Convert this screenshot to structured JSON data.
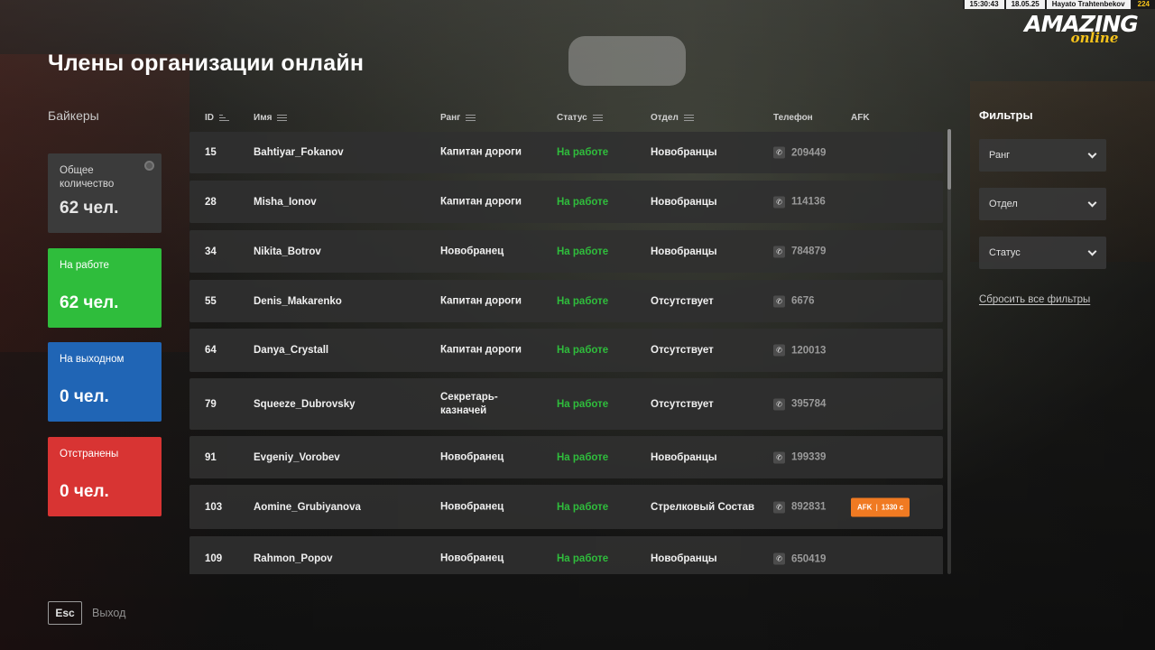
{
  "hud": {
    "time": "15:30:43",
    "date": "18.05.25",
    "player": "Hayato Trahtenbekov",
    "player_id": "224"
  },
  "logo": {
    "line1": "AMAZING",
    "line2": "online"
  },
  "page_title": "Члены организации онлайн",
  "org_name": "Байкеры",
  "stats": {
    "total": {
      "label": "Общее количество",
      "value": "62 чел."
    },
    "working": {
      "label": "На работе",
      "value": "62 чел."
    },
    "day_off": {
      "label": "На выходном",
      "value": "0 чел."
    },
    "suspended": {
      "label": "Отстранены",
      "value": "0 чел."
    }
  },
  "columns": {
    "id": "ID",
    "name": "Имя",
    "rank": "Ранг",
    "status": "Статус",
    "dept": "Отдел",
    "phone": "Телефон",
    "afk": "AFK"
  },
  "members": [
    {
      "id": "15",
      "name": "Bahtiyar_Fokanov",
      "rank": "Капитан дороги",
      "status": "На работе",
      "dept": "Новобранцы",
      "phone": "209449",
      "afk": ""
    },
    {
      "id": "28",
      "name": "Misha_Ionov",
      "rank": "Капитан дороги",
      "status": "На работе",
      "dept": "Новобранцы",
      "phone": "114136",
      "afk": ""
    },
    {
      "id": "34",
      "name": "Nikita_Botrov",
      "rank": "Новобранец",
      "status": "На работе",
      "dept": "Новобранцы",
      "phone": "784879",
      "afk": ""
    },
    {
      "id": "55",
      "name": "Denis_Makarenko",
      "rank": "Капитан дороги",
      "status": "На работе",
      "dept": "Отсутствует",
      "phone": "6676",
      "afk": ""
    },
    {
      "id": "64",
      "name": "Danya_Crystall",
      "rank": "Капитан дороги",
      "status": "На работе",
      "dept": "Отсутствует",
      "phone": "120013",
      "afk": ""
    },
    {
      "id": "79",
      "name": "Squeeze_Dubrovsky",
      "rank": "Секретарь-казначей",
      "rank_l1": "Секретарь-",
      "rank_l2": "казначей",
      "status": "На работе",
      "dept": "Отсутствует",
      "phone": "395784",
      "afk": ""
    },
    {
      "id": "91",
      "name": "Evgeniy_Vorobev",
      "rank": "Новобранец",
      "status": "На работе",
      "dept": "Новобранцы",
      "phone": "199339",
      "afk": ""
    },
    {
      "id": "103",
      "name": "Aomine_Grubiyanova",
      "rank": "Новобранец",
      "status": "На работе",
      "dept": "Стрелковый Состав",
      "phone": "892831",
      "afk": "1330 с"
    },
    {
      "id": "109",
      "name": "Rahmon_Popov",
      "rank": "Новобранец",
      "status": "На работе",
      "dept": "Новобранцы",
      "phone": "650419",
      "afk": ""
    }
  ],
  "afk_badge_label": "AFK",
  "filters": {
    "title": "Фильтры",
    "rank": "Ранг",
    "dept": "Отдел",
    "status": "Статус",
    "reset": "Сбросить все фильтры"
  },
  "footer": {
    "esc_key": "Esc",
    "exit_label": "Выход"
  },
  "colors": {
    "working": "#2fbd3c",
    "day_off": "#2065b5",
    "suspended": "#d83433",
    "total": "#3b3b3b",
    "afk": "#f07a22",
    "accent": "#f6c31b"
  },
  "icons": [
    "phone-icon",
    "chevron-down-icon",
    "sort-icon",
    "menu-lines-icon"
  ]
}
